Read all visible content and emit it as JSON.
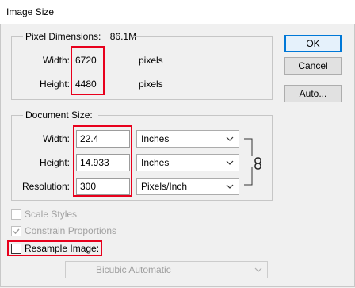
{
  "window": {
    "title": "Image Size"
  },
  "pixel_dimensions": {
    "label": "Pixel Dimensions:",
    "size": "86.1M",
    "width_label": "Width:",
    "width_value": "6720",
    "width_unit": "pixels",
    "height_label": "Height:",
    "height_value": "4480",
    "height_unit": "pixels"
  },
  "document_size": {
    "label": "Document Size:",
    "width_label": "Width:",
    "width_value": "22.4",
    "width_unit": "Inches",
    "height_label": "Height:",
    "height_value": "14.933",
    "height_unit": "Inches",
    "resolution_label": "Resolution:",
    "resolution_value": "300",
    "resolution_unit": "Pixels/Inch",
    "link_icon": "chain-link-icon"
  },
  "options": {
    "scale_styles": {
      "label": "Scale Styles",
      "checked": false,
      "enabled": false
    },
    "constrain_proportions": {
      "label": "Constrain Proportions",
      "checked": true,
      "enabled": false
    },
    "resample_image": {
      "label": "Resample Image:",
      "checked": false,
      "enabled": true
    },
    "resample_method": "Bicubic Automatic"
  },
  "buttons": {
    "ok": "OK",
    "cancel": "Cancel",
    "auto": "Auto..."
  },
  "colors": {
    "highlight": "#e8001c",
    "accent": "#0078d7",
    "background": "#f0f0f0"
  }
}
